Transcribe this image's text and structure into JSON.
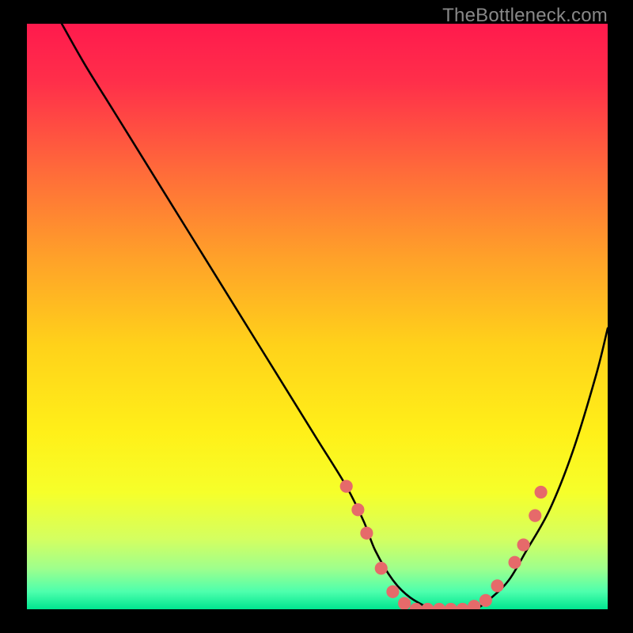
{
  "watermark": "TheBottleneck.com",
  "chart_data": {
    "type": "line",
    "title": "",
    "xlabel": "",
    "ylabel": "",
    "xlim": [
      0,
      100
    ],
    "ylim": [
      0,
      100
    ],
    "gradient_stops": [
      {
        "offset": 0.0,
        "color": "#ff1a4d"
      },
      {
        "offset": 0.1,
        "color": "#ff2f4a"
      },
      {
        "offset": 0.25,
        "color": "#ff6a3a"
      },
      {
        "offset": 0.4,
        "color": "#ffa129"
      },
      {
        "offset": 0.55,
        "color": "#ffd21a"
      },
      {
        "offset": 0.7,
        "color": "#fff019"
      },
      {
        "offset": 0.8,
        "color": "#f6ff2a"
      },
      {
        "offset": 0.88,
        "color": "#d4ff60"
      },
      {
        "offset": 0.93,
        "color": "#9fff8c"
      },
      {
        "offset": 0.97,
        "color": "#4dffad"
      },
      {
        "offset": 1.0,
        "color": "#00e58f"
      }
    ],
    "series": [
      {
        "name": "bottleneck-curve",
        "x": [
          6,
          10,
          15,
          20,
          25,
          30,
          35,
          40,
          45,
          50,
          55,
          58,
          60,
          63,
          66,
          70,
          73,
          77,
          80,
          83,
          86,
          90,
          94,
          98,
          100
        ],
        "y": [
          100,
          93,
          85,
          77,
          69,
          61,
          53,
          45,
          37,
          29,
          21,
          15,
          10,
          5,
          2,
          0,
          0,
          0,
          2,
          5,
          10,
          17,
          27,
          40,
          48
        ]
      }
    ],
    "markers": {
      "name": "data-points",
      "color": "#e66a6a",
      "radius_pct": 1.1,
      "points": [
        {
          "x": 55.0,
          "y": 21.0
        },
        {
          "x": 57.0,
          "y": 17.0
        },
        {
          "x": 58.5,
          "y": 13.0
        },
        {
          "x": 61.0,
          "y": 7.0
        },
        {
          "x": 63.0,
          "y": 3.0
        },
        {
          "x": 65.0,
          "y": 1.0
        },
        {
          "x": 67.0,
          "y": 0.0
        },
        {
          "x": 69.0,
          "y": 0.0
        },
        {
          "x": 71.0,
          "y": 0.0
        },
        {
          "x": 73.0,
          "y": 0.0
        },
        {
          "x": 75.0,
          "y": 0.0
        },
        {
          "x": 77.0,
          "y": 0.5
        },
        {
          "x": 79.0,
          "y": 1.5
        },
        {
          "x": 81.0,
          "y": 4.0
        },
        {
          "x": 84.0,
          "y": 8.0
        },
        {
          "x": 85.5,
          "y": 11.0
        },
        {
          "x": 87.5,
          "y": 16.0
        },
        {
          "x": 88.5,
          "y": 20.0
        }
      ]
    }
  }
}
